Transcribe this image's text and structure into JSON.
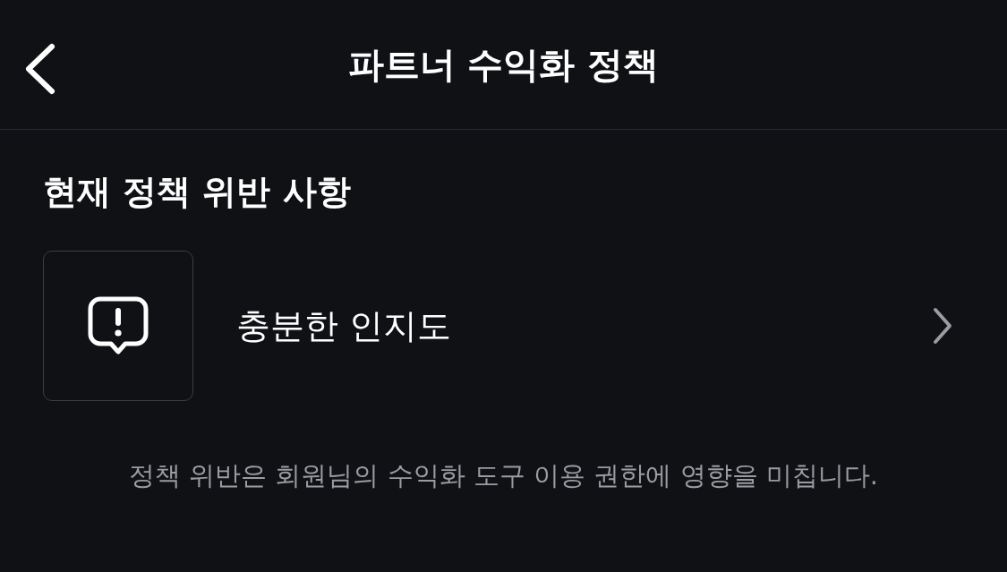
{
  "header": {
    "title": "파트너 수익화 정책"
  },
  "section": {
    "title": "현재 정책 위반 사항"
  },
  "items": [
    {
      "label": "충분한 인지도"
    }
  ],
  "footer": {
    "text": "정책 위반은 회원님의 수익화 도구 이용 권한에 영향을 미칩니다."
  }
}
